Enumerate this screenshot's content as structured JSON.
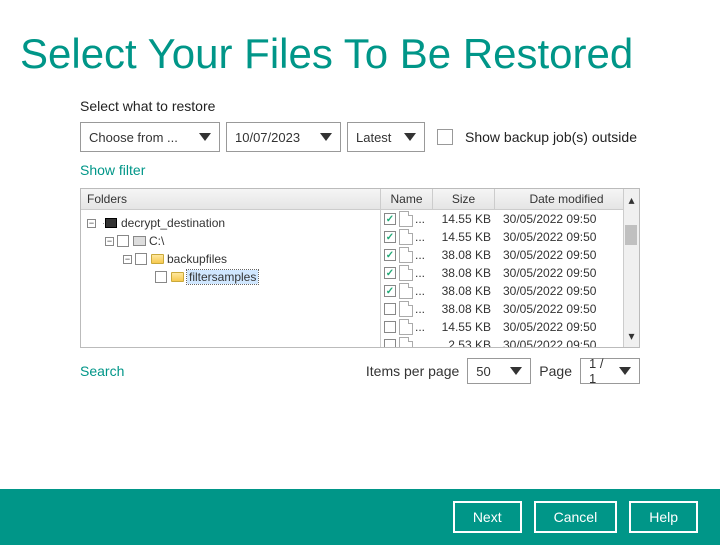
{
  "title": "Select Your Files To Be Restored",
  "restore_label": "Select what to restore",
  "dropdowns": {
    "source": "Choose from ...",
    "date": "10/07/2023",
    "version": "Latest"
  },
  "show_outside": "Show backup job(s) outside",
  "show_filter": "Show filter",
  "folders_header": "Folders",
  "tree": {
    "root": "decrypt_destination",
    "drive": "C:\\",
    "folder1": "backupfiles",
    "folder2": "filtersamples"
  },
  "columns": {
    "name": "Name",
    "size": "Size",
    "date": "Date modified"
  },
  "files": [
    {
      "checked": true,
      "name": "...",
      "size": "14.55 KB",
      "date": "30/05/2022 09:50"
    },
    {
      "checked": true,
      "name": "...",
      "size": "14.55 KB",
      "date": "30/05/2022 09:50"
    },
    {
      "checked": true,
      "name": "...",
      "size": "38.08 KB",
      "date": "30/05/2022 09:50"
    },
    {
      "checked": true,
      "name": "...",
      "size": "38.08 KB",
      "date": "30/05/2022 09:50"
    },
    {
      "checked": true,
      "name": "...",
      "size": "38.08 KB",
      "date": "30/05/2022 09:50"
    },
    {
      "checked": false,
      "name": "...",
      "size": "38.08 KB",
      "date": "30/05/2022 09:50"
    },
    {
      "checked": false,
      "name": "...",
      "size": "14.55 KB",
      "date": "30/05/2022 09:50"
    },
    {
      "checked": false,
      "name": "...",
      "size": "2.53 KB",
      "date": "30/05/2022 09:50"
    }
  ],
  "search": "Search",
  "pager": {
    "items_label": "Items per page",
    "items_value": "50",
    "page_label": "Page",
    "page_value": "1 / 1"
  },
  "buttons": {
    "next": "Next",
    "cancel": "Cancel",
    "help": "Help"
  }
}
